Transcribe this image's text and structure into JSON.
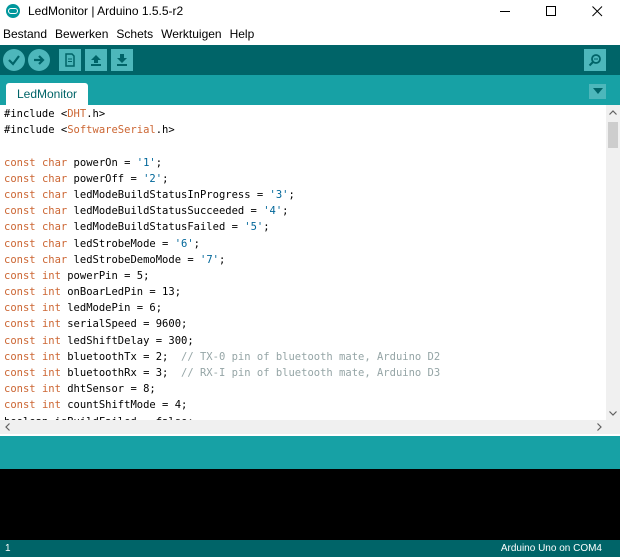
{
  "window": {
    "title": "LedMonitor | Arduino 1.5.5-r2",
    "controls": [
      "minimize",
      "maximize",
      "close"
    ]
  },
  "menu": {
    "items": [
      "Bestand",
      "Bewerken",
      "Schets",
      "Werktuigen",
      "Help"
    ]
  },
  "toolbar": {
    "buttons": [
      {
        "name": "verify",
        "icon": "check-icon"
      },
      {
        "name": "upload",
        "icon": "arrow-right-icon"
      },
      {
        "name": "new",
        "icon": "new-file-icon"
      },
      {
        "name": "open",
        "icon": "arrow-up-icon"
      },
      {
        "name": "save",
        "icon": "arrow-down-icon"
      }
    ],
    "serial_monitor_icon": "magnifier-icon"
  },
  "tabs": {
    "items": [
      {
        "label": "LedMonitor",
        "active": true
      }
    ],
    "menu_icon": "triangle-down-icon"
  },
  "editor": {
    "lines": [
      [
        {
          "t": "#include <",
          "c": ""
        },
        {
          "t": "DHT",
          "c": "kw"
        },
        {
          "t": ".h>",
          "c": ""
        }
      ],
      [
        {
          "t": "#include <",
          "c": ""
        },
        {
          "t": "SoftwareSerial",
          "c": "kw"
        },
        {
          "t": ".h>",
          "c": ""
        }
      ],
      [
        {
          "t": "",
          "c": ""
        }
      ],
      [
        {
          "t": "const",
          "c": "kw"
        },
        {
          "t": " ",
          "c": ""
        },
        {
          "t": "char",
          "c": "kw"
        },
        {
          "t": " powerOn = ",
          "c": ""
        },
        {
          "t": "'1'",
          "c": "str"
        },
        {
          "t": ";",
          "c": ""
        }
      ],
      [
        {
          "t": "const",
          "c": "kw"
        },
        {
          "t": " ",
          "c": ""
        },
        {
          "t": "char",
          "c": "kw"
        },
        {
          "t": " powerOff = ",
          "c": ""
        },
        {
          "t": "'2'",
          "c": "str"
        },
        {
          "t": ";",
          "c": ""
        }
      ],
      [
        {
          "t": "const",
          "c": "kw"
        },
        {
          "t": " ",
          "c": ""
        },
        {
          "t": "char",
          "c": "kw"
        },
        {
          "t": " ledModeBuildStatusInProgress = ",
          "c": ""
        },
        {
          "t": "'3'",
          "c": "str"
        },
        {
          "t": ";",
          "c": ""
        }
      ],
      [
        {
          "t": "const",
          "c": "kw"
        },
        {
          "t": " ",
          "c": ""
        },
        {
          "t": "char",
          "c": "kw"
        },
        {
          "t": " ledModeBuildStatusSucceeded = ",
          "c": ""
        },
        {
          "t": "'4'",
          "c": "str"
        },
        {
          "t": ";",
          "c": ""
        }
      ],
      [
        {
          "t": "const",
          "c": "kw"
        },
        {
          "t": " ",
          "c": ""
        },
        {
          "t": "char",
          "c": "kw"
        },
        {
          "t": " ledModeBuildStatusFailed = ",
          "c": ""
        },
        {
          "t": "'5'",
          "c": "str"
        },
        {
          "t": ";",
          "c": ""
        }
      ],
      [
        {
          "t": "const",
          "c": "kw"
        },
        {
          "t": " ",
          "c": ""
        },
        {
          "t": "char",
          "c": "kw"
        },
        {
          "t": " ledStrobeMode = ",
          "c": ""
        },
        {
          "t": "'6'",
          "c": "str"
        },
        {
          "t": ";",
          "c": ""
        }
      ],
      [
        {
          "t": "const",
          "c": "kw"
        },
        {
          "t": " ",
          "c": ""
        },
        {
          "t": "char",
          "c": "kw"
        },
        {
          "t": " ledStrobeDemoMode = ",
          "c": ""
        },
        {
          "t": "'7'",
          "c": "str"
        },
        {
          "t": ";",
          "c": ""
        }
      ],
      [
        {
          "t": "const",
          "c": "kw"
        },
        {
          "t": " ",
          "c": ""
        },
        {
          "t": "int",
          "c": "kw"
        },
        {
          "t": " powerPin = 5;",
          "c": ""
        }
      ],
      [
        {
          "t": "const",
          "c": "kw"
        },
        {
          "t": " ",
          "c": ""
        },
        {
          "t": "int",
          "c": "kw"
        },
        {
          "t": " onBoarLedPin = 13;",
          "c": ""
        }
      ],
      [
        {
          "t": "const",
          "c": "kw"
        },
        {
          "t": " ",
          "c": ""
        },
        {
          "t": "int",
          "c": "kw"
        },
        {
          "t": " ledModePin = 6;",
          "c": ""
        }
      ],
      [
        {
          "t": "const",
          "c": "kw"
        },
        {
          "t": " ",
          "c": ""
        },
        {
          "t": "int",
          "c": "kw"
        },
        {
          "t": " serialSpeed = 9600;",
          "c": ""
        }
      ],
      [
        {
          "t": "const",
          "c": "kw"
        },
        {
          "t": " ",
          "c": ""
        },
        {
          "t": "int",
          "c": "kw"
        },
        {
          "t": " ledShiftDelay = 300;",
          "c": ""
        }
      ],
      [
        {
          "t": "const",
          "c": "kw"
        },
        {
          "t": " ",
          "c": ""
        },
        {
          "t": "int",
          "c": "kw"
        },
        {
          "t": " bluetoothTx = 2;  ",
          "c": ""
        },
        {
          "t": "// TX-0 pin of bluetooth mate, Arduino D2",
          "c": "cm"
        }
      ],
      [
        {
          "t": "const",
          "c": "kw"
        },
        {
          "t": " ",
          "c": ""
        },
        {
          "t": "int",
          "c": "kw"
        },
        {
          "t": " bluetoothRx = 3;  ",
          "c": ""
        },
        {
          "t": "// RX-I pin of bluetooth mate, Arduino D3",
          "c": "cm"
        }
      ],
      [
        {
          "t": "const",
          "c": "kw"
        },
        {
          "t": " ",
          "c": ""
        },
        {
          "t": "int",
          "c": "kw"
        },
        {
          "t": " dhtSensor = 8;",
          "c": ""
        }
      ],
      [
        {
          "t": "const",
          "c": "kw"
        },
        {
          "t": " ",
          "c": ""
        },
        {
          "t": "int",
          "c": "kw"
        },
        {
          "t": " countShiftMode = 4;",
          "c": ""
        }
      ],
      [
        {
          "t": "boolean isBuildFailed = false;",
          "c": ""
        }
      ]
    ]
  },
  "status": {
    "line_number": "1",
    "board": "Arduino Uno on COM4"
  },
  "colors": {
    "toolbar_bg": "#006468",
    "tabbar_bg": "#17a1a5",
    "button_bg": "#4db7bb",
    "keyword": "#cc6633",
    "string": "#006699",
    "comment": "#95a5a6"
  }
}
